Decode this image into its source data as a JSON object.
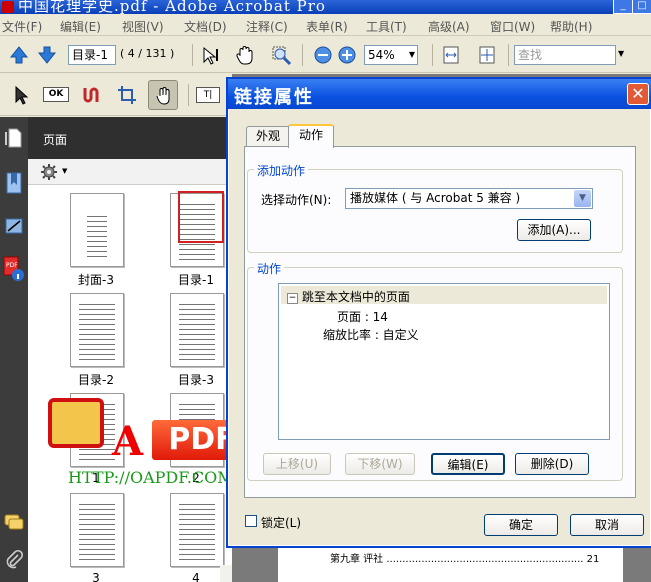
{
  "window": {
    "title": "中国花理学史.pdf - Adobe Acrobat Pro"
  },
  "menu": [
    "文件(F)",
    "编辑(E)",
    "视图(V)",
    "文档(D)",
    "注释(C)",
    "表单(R)",
    "工具(T)",
    "高级(A)",
    "窗口(W)",
    "帮助(H)"
  ],
  "toolbar": {
    "page_field": "目录-1",
    "page_count": "( 4 / 131 )",
    "zoom": "54%",
    "search_placeholder": "查找"
  },
  "nav": {
    "title": "页面",
    "thumbnails": [
      {
        "label": "封面-3",
        "selected": false
      },
      {
        "label": "目录-1",
        "selected": true
      },
      {
        "label": "目录-2",
        "selected": false
      },
      {
        "label": "目录-3",
        "selected": false
      },
      {
        "label": "1",
        "selected": false
      },
      {
        "label": "2",
        "selected": false
      },
      {
        "label": "3",
        "selected": false
      },
      {
        "label": "4",
        "selected": false
      }
    ]
  },
  "watermark": {
    "a": "A",
    "pdf": "PDF",
    "url": "HTTP://OAPDF.COM"
  },
  "doc": {
    "visible_line": "第九章  评社 .............................................................. 21"
  },
  "dialog": {
    "title": "链接属性",
    "tabs": [
      "外观",
      "动作"
    ],
    "active_tab": "动作",
    "add_action": {
      "caption": "添加动作",
      "select_label": "选择动作(N):",
      "select_value": "播放媒体 ( 与 Acrobat 5 兼容 )",
      "add_button": "添加(A)..."
    },
    "actions": {
      "caption": "动作",
      "tree": {
        "root": "跳至本文档中的页面",
        "children": [
          "页面 : 14",
          "缩放比率 : 自定义"
        ]
      },
      "buttons": {
        "move_up": "上移(U)",
        "move_down": "下移(W)",
        "edit": "编辑(E)",
        "delete": "删除(D)"
      }
    },
    "lock_label": "锁定(L)",
    "ok": "确定",
    "cancel": "取消"
  }
}
